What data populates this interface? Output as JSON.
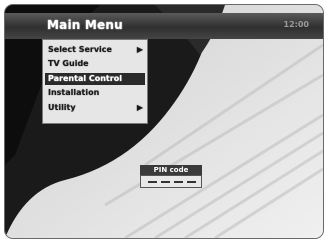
{
  "header": {
    "title": "Main Menu",
    "right_text": "12:00"
  },
  "menu": {
    "items": [
      {
        "label": "Select Service",
        "arrow": "▶"
      },
      {
        "label": "TV Guide",
        "arrow": ""
      },
      {
        "label": "Parental Control",
        "arrow": ""
      },
      {
        "label": "Installation",
        "arrow": ""
      },
      {
        "label": "Utility",
        "arrow": "▶"
      }
    ],
    "selected_index": 2
  },
  "pin_dialog": {
    "title": "PIN code",
    "dashes": [
      "–",
      "–",
      "–",
      "–"
    ]
  },
  "colors": {
    "selected_bg": "#2a2a2a",
    "menu_bg": "#e6e6e6",
    "title_bar": "#333333"
  }
}
